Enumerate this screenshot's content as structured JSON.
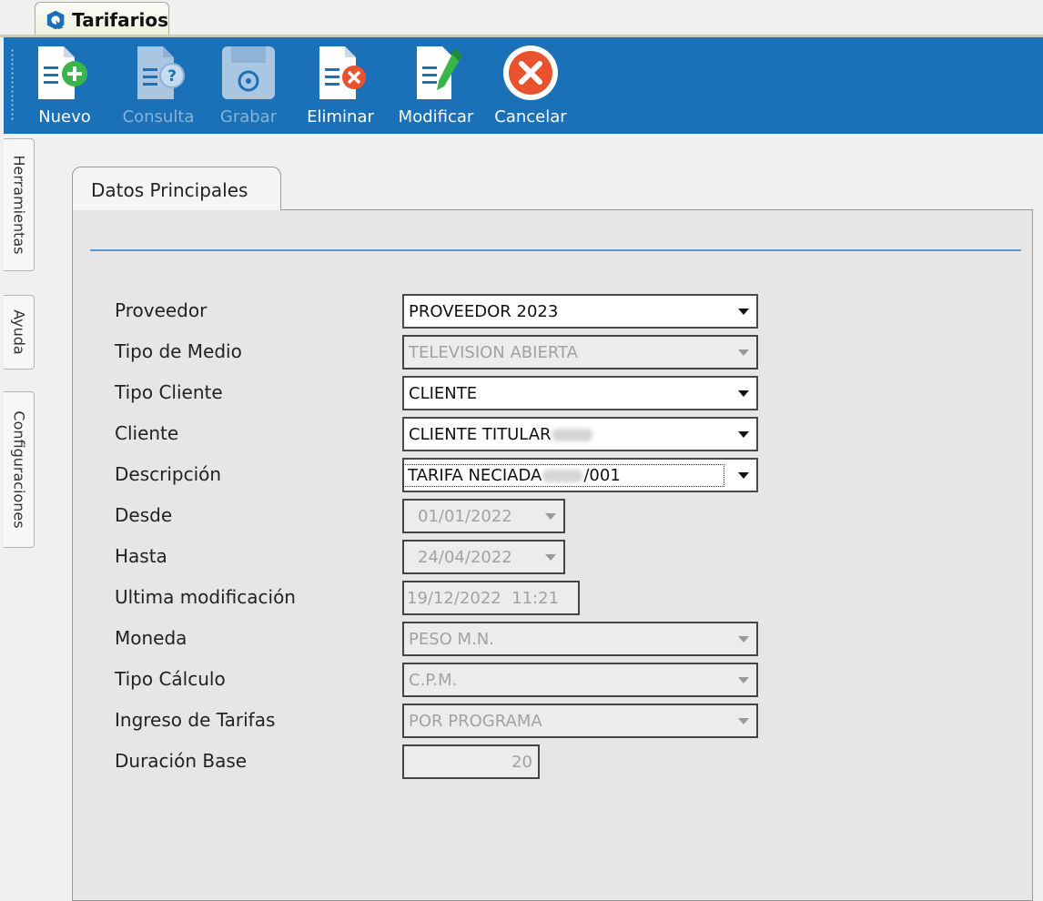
{
  "window": {
    "tab_title": "Tarifarios",
    "logo_icon": "app-logo-icon"
  },
  "toolbar": {
    "buttons": [
      {
        "label": "Nuevo",
        "icon": "new-document-icon",
        "enabled": true
      },
      {
        "label": "Consulta",
        "icon": "query-document-icon",
        "enabled": false
      },
      {
        "label": "Grabar",
        "icon": "save-disk-icon",
        "enabled": false
      },
      {
        "label": "Eliminar",
        "icon": "delete-document-icon",
        "enabled": true
      },
      {
        "label": "Modificar",
        "icon": "edit-document-icon",
        "enabled": true
      },
      {
        "label": "Cancelar",
        "icon": "cancel-icon",
        "enabled": true
      }
    ],
    "color": "#1b71b8"
  },
  "sidetabs": [
    "Herramientas",
    "Ayuda",
    "Configuraciones"
  ],
  "panel": {
    "tab_label": "Datos Principales"
  },
  "form": {
    "proveedor": {
      "label": "Proveedor",
      "value": "PROVEEDOR 2023"
    },
    "tipo_medio": {
      "label": "Tipo de Medio",
      "value": "TELEVISION ABIERTA"
    },
    "tipo_cliente": {
      "label": "Tipo Cliente",
      "value": "CLIENTE"
    },
    "cliente": {
      "label": "Cliente",
      "value_prefix": "CLIENTE TITULAR"
    },
    "descripcion": {
      "label": "Descripción",
      "value_prefix": "TARIFA NECIADA",
      "value_suffix": "/001"
    },
    "desde": {
      "label": "Desde",
      "value": "01/01/2022"
    },
    "hasta": {
      "label": "Hasta",
      "value": "24/04/2022"
    },
    "ultima_mod": {
      "label": "Ultima modificación",
      "value": "19/12/2022  11:21"
    },
    "moneda": {
      "label": "Moneda",
      "value": "PESO M.N."
    },
    "tipo_calculo": {
      "label": "Tipo Cálculo",
      "value": "C.P.M."
    },
    "ingreso_tarifas": {
      "label": "Ingreso de Tarifas",
      "value": "POR PROGRAMA"
    },
    "duracion_base": {
      "label": "Duración Base",
      "value": "20"
    }
  }
}
